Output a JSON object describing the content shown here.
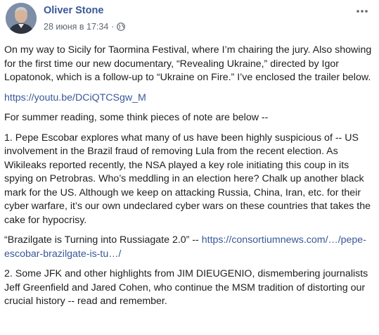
{
  "post": {
    "author": "Oliver Stone",
    "timestamp": "28 июня в 17:34",
    "separator": "·",
    "privacy_icon": "globe-icon",
    "more_icon": "more-dots-icon",
    "paragraphs": {
      "intro": "On my way to Sicily for Taormina Festival, where I’m chairing the jury. Also showing for the first time our new documentary, “Revealing Ukraine,” directed by Igor Lopatonok, which is a follow-up to “Ukraine on Fire.” I’ve enclosed the trailer below.",
      "youtube_link": "https://youtu.be/DCiQTCSgw_M",
      "summer": "For summer reading, some think pieces of note are below --",
      "item1": "1. Pepe Escobar explores what many of us have been highly suspicious of -- US involvement in the Brazil fraud of removing Lula from the recent election. As Wikileaks reported recently, the NSA played a key role initiating this coup in its spying on Petrobras. Who’s meddling in an election here? Chalk up another black mark for the US. Although we keep on attacking Russia, China, Iran, etc. for their cyber warfare, it’s our own undeclared cyber wars on these countries that takes the cake for hypocrisy.",
      "quote_text": "“Brazilgate is Turning into Russiagate 2.0” -- ",
      "quote_link": "https://consortiumnews.com/…/pepe-escobar-brazilgate-is-tu…/",
      "item2": "2. Some JFK and other highlights from JIM DIEUGENIO, dismembering journalists Jeff Greenfield and Jared Cohen, who continue the MSM tradition of distorting our crucial history -- read and remember."
    }
  },
  "colors": {
    "link": "#385898",
    "text": "#1c1e21",
    "meta": "#606770"
  }
}
